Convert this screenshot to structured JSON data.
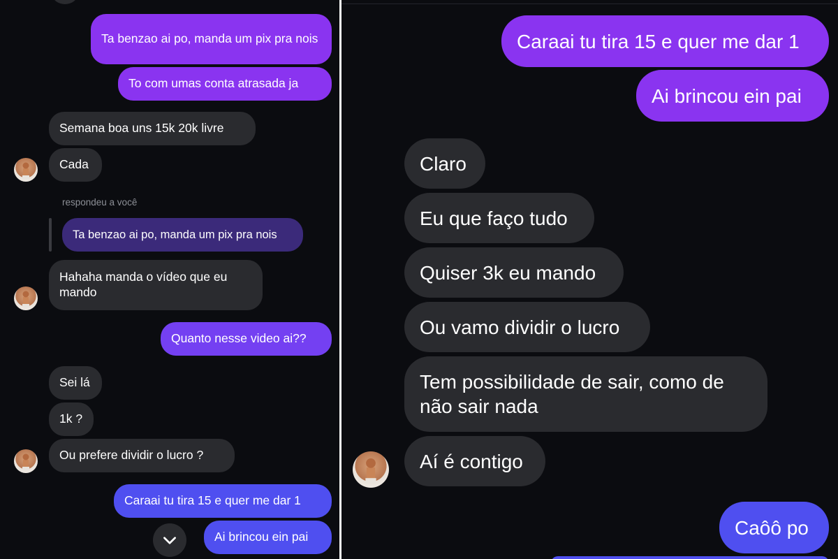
{
  "left": {
    "sent": [
      "Ta benzao ai po, manda um pix pra nois",
      "To com umas conta atrasada ja"
    ],
    "received_1": [
      "Semana boa uns 15k 20k livre",
      "Cada"
    ],
    "reply_label": "respondeu a você",
    "quoted_text": "Ta benzao ai po, manda um pix pra nois",
    "received_2": "Hahaha manda o vídeo que eu mando",
    "sent_2": "Quanto nesse video ai??",
    "received_3": [
      "Sei lá",
      "1k ?",
      "Ou prefere dividir o lucro ?"
    ],
    "sent_3": [
      "Caraai tu tira 15 e quer me dar 1",
      "Ai brincou ein pai"
    ]
  },
  "right": {
    "sent": [
      "Caraai tu tira 15 e quer me dar 1",
      "Ai brincou ein pai"
    ],
    "received": [
      "Claro",
      "Eu que faço tudo",
      "Quiser 3k eu mando",
      "Ou vamo dividir o lucro",
      "Tem possibilidade de sair, como de não sair nada",
      "Aí é contigo"
    ],
    "sent_2": "Caôô po"
  },
  "icons": {
    "avatar": "contact-avatar",
    "scroll_down": "chevron-down-icon"
  },
  "colors": {
    "background": "#0b0c10",
    "received_bubble": "#2a2b2f",
    "sent_purple": "#8a34f0",
    "sent_violet": "#7440f2",
    "sent_blue": "#4f4ff0"
  }
}
